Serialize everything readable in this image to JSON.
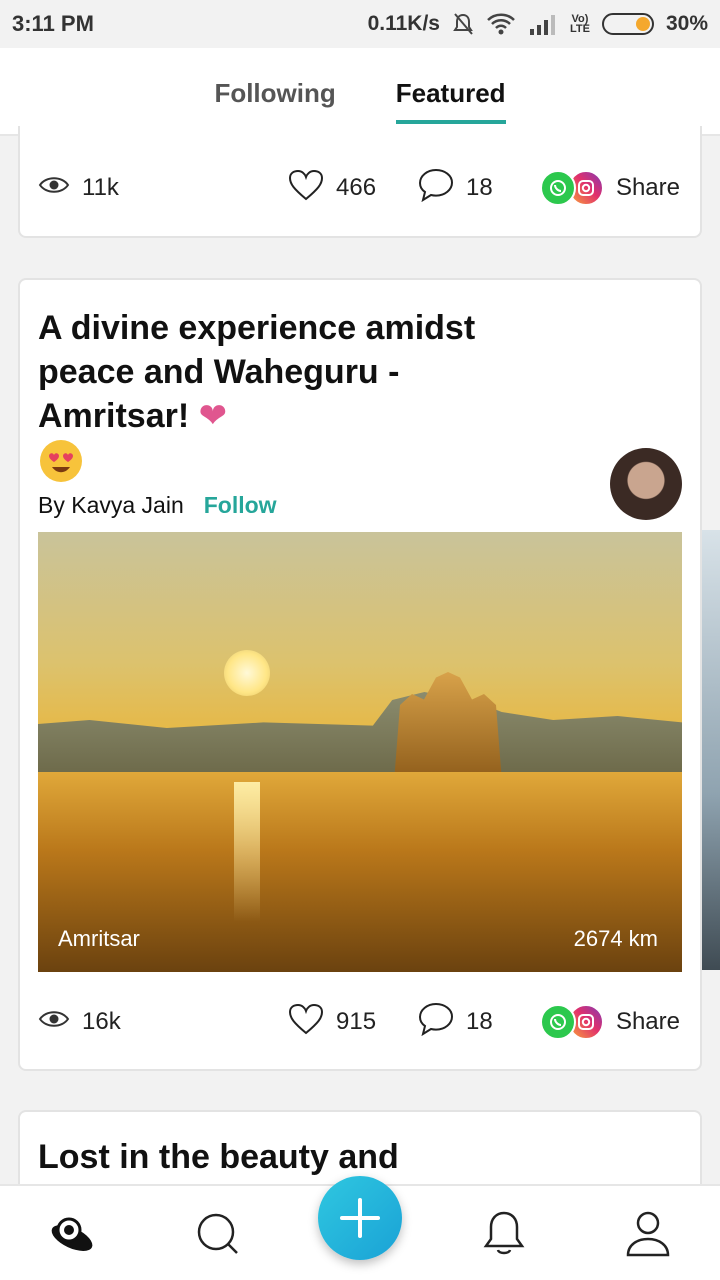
{
  "status_bar": {
    "time": "3:11 PM",
    "network_speed": "0.11K/s",
    "volte_line1": "Vo)",
    "volte_line2": "LTE",
    "battery": "30%",
    "battery_level_percent": 30
  },
  "top_tabs": [
    {
      "label": "Following",
      "active": false
    },
    {
      "label": "Featured",
      "active": true
    }
  ],
  "cards": [
    {
      "stats": {
        "views": "11k",
        "likes": "466",
        "comments": "18",
        "share_label": "Share"
      }
    },
    {
      "title": "A divine experience amidst peace and Waheguru - Amritsar!",
      "title_emoji": "❤",
      "author_prefix": "By Kavya Jain",
      "follow_label": "Follow",
      "photo": {
        "location": "Amritsar",
        "distance": "2674 km"
      },
      "stats": {
        "views": "16k",
        "likes": "915",
        "comments": "18",
        "share_label": "Share"
      }
    },
    {
      "title": "Lost in the beauty and"
    }
  ],
  "bottom_nav": {
    "items": [
      "home-icon",
      "search-icon",
      "add-icon",
      "notifications-icon",
      "profile-icon"
    ]
  },
  "colors": {
    "accent": "#26a69a",
    "fab": "#1aa2d6",
    "heart_emoji": "#e0568f"
  }
}
